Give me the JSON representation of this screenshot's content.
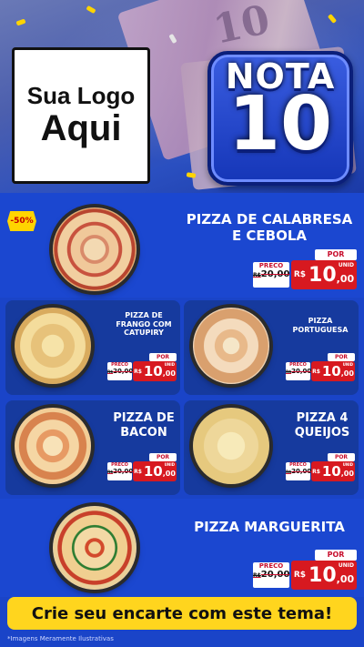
{
  "logo": {
    "line1": "Sua Logo",
    "line2": "Aqui"
  },
  "badge": {
    "word": "NOTA",
    "number": "10"
  },
  "banknote_value": "10",
  "featured": {
    "discount": "-50%",
    "title_line1": "PIZZA DE CALABRESA",
    "title_line2": "E CEBOLA",
    "price": {
      "por": "POR",
      "preco": "PRECO",
      "old_prefix": "R$",
      "old": "20,00",
      "currency": "R$",
      "int": "10",
      "dec": ",00",
      "unit": "UNID"
    }
  },
  "items": [
    {
      "title_lines": [
        "PIZZA DE",
        "FRANGO COM",
        "CATUPIRY"
      ],
      "price": {
        "por": "POR",
        "preco": "PRECO",
        "old_prefix": "R$",
        "old": "20,00",
        "currency": "R$",
        "int": "10",
        "dec": ",00",
        "unit": "UNID"
      }
    },
    {
      "title_lines": [
        "PIZZA",
        "PORTUGUESA"
      ],
      "price": {
        "por": "POR",
        "preco": "PRECO",
        "old_prefix": "R$",
        "old": "20,00",
        "currency": "R$",
        "int": "10",
        "dec": ",00",
        "unit": "UNID"
      }
    },
    {
      "title_lines": [
        "PIZZA DE",
        "BACON"
      ],
      "price": {
        "por": "POR",
        "preco": "PRECO",
        "old_prefix": "R$",
        "old": "20,00",
        "currency": "R$",
        "int": "10",
        "dec": ",00",
        "unit": "UNID"
      }
    },
    {
      "title_lines": [
        "PIZZA 4",
        "QUEIJOS"
      ],
      "price": {
        "por": "POR",
        "preco": "PRECO",
        "old_prefix": "R$",
        "old": "20,00",
        "currency": "R$",
        "int": "10",
        "dec": ",00",
        "unit": "UNID"
      }
    }
  ],
  "bottom_featured": {
    "title": "PIZZA MARGUERITA",
    "price": {
      "por": "POR",
      "preco": "PRECO",
      "old_prefix": "R$",
      "old": "20,00",
      "currency": "R$",
      "int": "10",
      "dec": ",00",
      "unit": "UNID"
    }
  },
  "cta": "Crie seu encarte com este tema!",
  "footer_note": "*Imagens Meramente Ilustrativas",
  "colors": {
    "accent_red": "#d71920",
    "cta_yellow": "#ffd51e",
    "panel_blue": "#163a9e",
    "background_blue": "#1a44c8"
  }
}
